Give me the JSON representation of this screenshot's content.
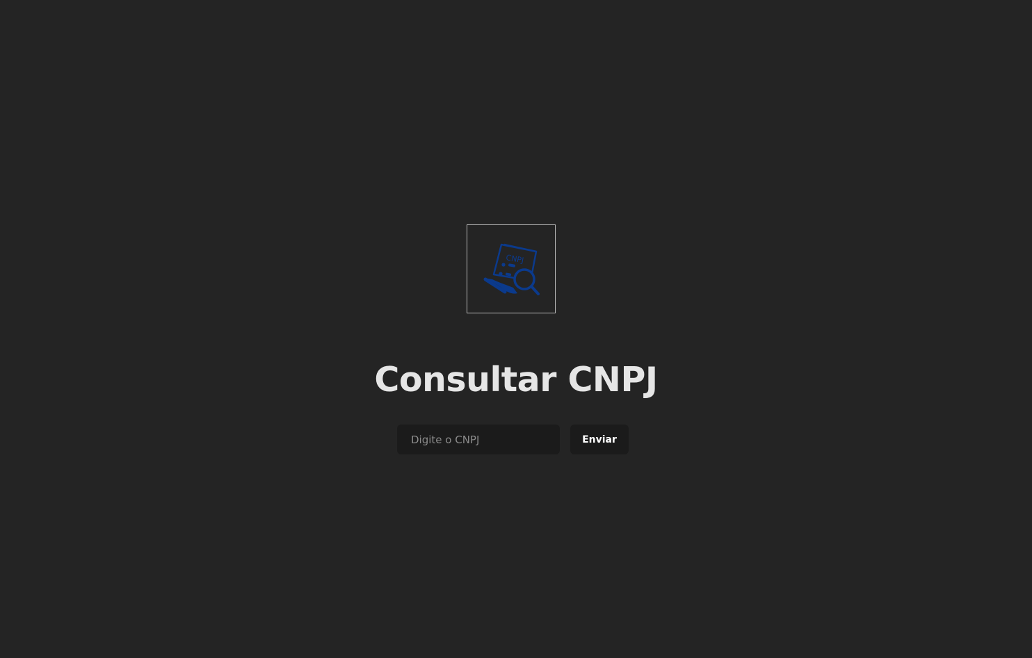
{
  "logo": {
    "icon": "cnpj-document-search-icon",
    "text": "CNPJ",
    "color": "#0b3a8c",
    "border_color": "#bdbdbd"
  },
  "title": "Consultar CNPJ",
  "form": {
    "input_placeholder": "Digite o CNPJ",
    "input_value": "",
    "submit_label": "Enviar"
  },
  "colors": {
    "background": "#242424",
    "control_background": "#1b1b1b",
    "title": "#e6e6e6"
  }
}
